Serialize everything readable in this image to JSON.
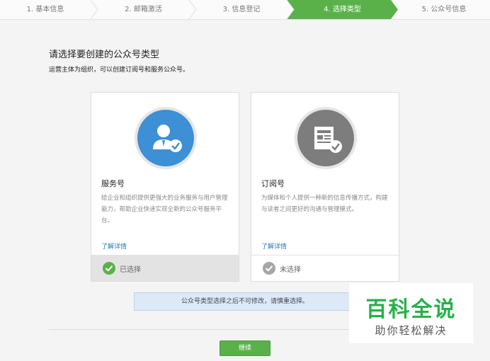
{
  "steps": [
    {
      "label": "1. 基本信息"
    },
    {
      "label": "2. 邮箱激活"
    },
    {
      "label": "3. 信息登记"
    },
    {
      "label": "4. 选择类型"
    },
    {
      "label": "5. 公众号信息"
    }
  ],
  "active_step": 4,
  "header": {
    "title": "请选择要创建的公众号类型",
    "subtitle": "运营主体为组织，可以创建订阅号和服务公众号。"
  },
  "cards": [
    {
      "title": "服务号",
      "desc": "给企业和组织提供更强大的业务服务与用户管理能力，帮助企业快速实现全新的公众号服务平台。",
      "link": "了解详情",
      "status": "已选择",
      "icon": "service-account-icon"
    },
    {
      "title": "订阅号",
      "desc": "为媒体和个人提供一种新的信息传播方式，构建与读者之间更好的沟通与管理模式。",
      "link": "了解详情",
      "status": "未选择",
      "icon": "subscription-account-icon"
    }
  ],
  "notice": "公众号类型选择之后不可修改，请慎重选择。",
  "continue_button": "继续",
  "watermark": {
    "line1": "百科全说",
    "line2": "助你轻松解决"
  },
  "colors": {
    "accent": "#5ab14a",
    "service_blue": "#3d8fd6",
    "subscription_gray": "#7d7d7d",
    "link": "#2a78b8"
  }
}
